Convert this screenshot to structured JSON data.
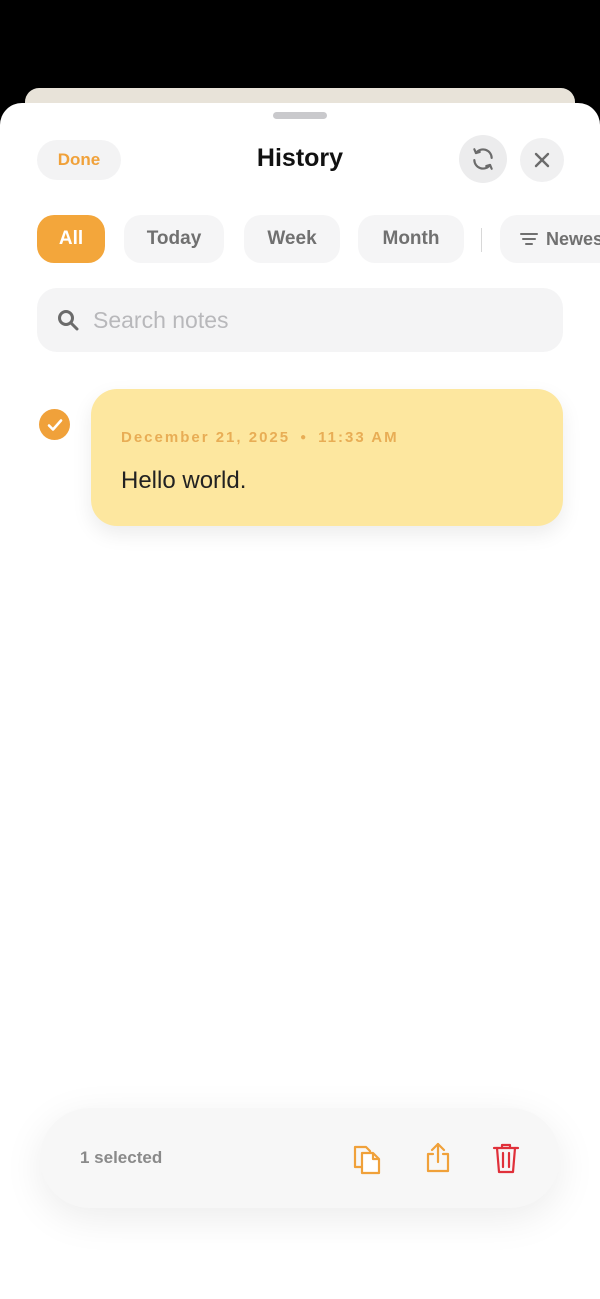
{
  "header": {
    "done_label": "Done",
    "title": "History",
    "sync_icon": "sync-icon",
    "close_icon": "close-icon"
  },
  "filters": {
    "items": [
      {
        "label": "All",
        "active": true
      },
      {
        "label": "Today",
        "active": false
      },
      {
        "label": "Week",
        "active": false
      },
      {
        "label": "Month",
        "active": false
      }
    ],
    "sort_label": "Newest"
  },
  "search": {
    "placeholder": "Search notes",
    "value": ""
  },
  "notes": [
    {
      "date": "December 21, 2025",
      "time": "11:33 AM",
      "text": "Hello world.",
      "selected": true
    }
  ],
  "action_bar": {
    "selected_text": "1 selected",
    "icons": [
      "copy-icon",
      "share-icon",
      "trash-icon"
    ]
  },
  "colors": {
    "accent": "#f3a63b",
    "note_bg": "#fde79f",
    "note_meta": "#e8ad55",
    "danger": "#e0303a"
  }
}
